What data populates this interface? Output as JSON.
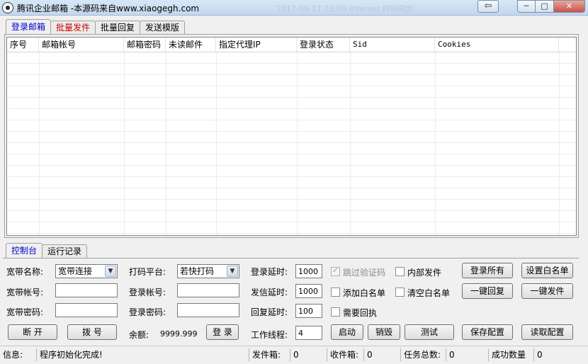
{
  "window": {
    "title": "腾讯企业邮箱 -本源码来自www.xiaogegh.com",
    "ghost_text": "2017-09-17 23:00   Internet 时间同步",
    "extra_button": "⇦",
    "min": "─",
    "max": "□",
    "close": "✕"
  },
  "top_tabs": [
    {
      "label": "登录邮箱",
      "color": "#0000cc"
    },
    {
      "label": "批量发件",
      "color": "#cc0000"
    },
    {
      "label": "批量回复",
      "color": "#000000"
    },
    {
      "label": "发送模版",
      "color": "#000000"
    }
  ],
  "table": {
    "columns": [
      "序号",
      "邮箱帐号",
      "邮箱密码",
      "未读邮件",
      "指定代理IP",
      "登录状态",
      "Sid",
      "Cookies"
    ],
    "rows": []
  },
  "bottom_tabs": [
    {
      "label": "控制台",
      "color": "#0000cc"
    },
    {
      "label": "运行记录",
      "color": "#000000"
    }
  ],
  "console": {
    "broadband_name_label": "宽带名称:",
    "broadband_name_value": "宽带连接",
    "broadband_account_label": "宽带帐号:",
    "broadband_account_value": "",
    "broadband_password_label": "宽带密码:",
    "broadband_password_value": "",
    "disconnect_button": "断 开",
    "dial_button": "拨 号",
    "captcha_platform_label": "打码平台:",
    "captcha_platform_value": "若快打码",
    "login_account_label": "登录帐号:",
    "login_account_value": "",
    "login_password_label": "登录密码:",
    "login_password_value": "",
    "balance_label": "余额:",
    "balance_value": "9999.999",
    "login_button": "登 录",
    "login_delay_label": "登录延时:",
    "login_delay_value": "1000",
    "send_delay_label": "发信延时:",
    "send_delay_value": "1000",
    "reply_delay_label": "回复延时:",
    "reply_delay_value": "100",
    "threads_label": "工作线程:",
    "threads_value": "4",
    "skip_captcha_label": "跳过验证码",
    "add_whitelist_label": "添加白名单",
    "need_reply_label": "需要回执",
    "internal_send_label": "内部发件",
    "clear_whitelist_label": "清空白名单",
    "start_button": "启动",
    "destroy_button": "销毁",
    "test_button": "测试",
    "login_all_button": "登录所有",
    "set_whitelist_button": "设置白名单",
    "one_click_reply_button": "一键回复",
    "one_click_send_button": "一键发件",
    "save_config_button": "保存配置",
    "load_config_button": "读取配置"
  },
  "status": {
    "info_label": "信息:",
    "info_value": "程序初始化完成!",
    "outbox_label": "发件箱:",
    "outbox_value": "0",
    "inbox_label": "收件箱:",
    "inbox_value": "0",
    "task_total_label": "任务总数:",
    "task_total_value": "0",
    "success_count_label": "成功数量",
    "success_count_value": "0"
  }
}
